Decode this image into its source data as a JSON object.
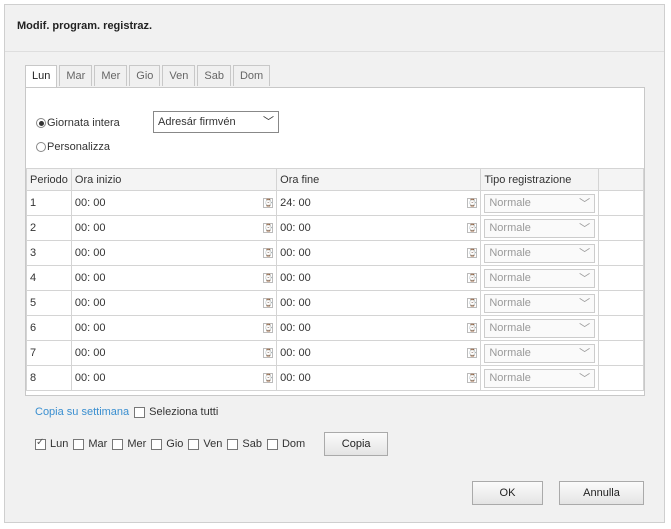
{
  "dialog": {
    "title": "Modif. program. registraz."
  },
  "tabs": [
    {
      "label": "Lun",
      "active": true
    },
    {
      "label": "Mar"
    },
    {
      "label": "Mer"
    },
    {
      "label": "Gio"
    },
    {
      "label": "Ven"
    },
    {
      "label": "Sab"
    },
    {
      "label": "Dom"
    }
  ],
  "mode": {
    "all_day_label": "Giornata intera",
    "all_day_select": "Adresár firmvén",
    "custom_label": "Personalizza"
  },
  "table": {
    "headers": [
      "Periodo",
      "Ora inizio",
      "Ora fine",
      "Tipo registrazione"
    ],
    "rows": [
      {
        "period": "1",
        "start": "00: 00",
        "end": "24: 00",
        "type": "Normale"
      },
      {
        "period": "2",
        "start": "00: 00",
        "end": "00: 00",
        "type": "Normale"
      },
      {
        "period": "3",
        "start": "00: 00",
        "end": "00: 00",
        "type": "Normale"
      },
      {
        "period": "4",
        "start": "00: 00",
        "end": "00: 00",
        "type": "Normale"
      },
      {
        "period": "5",
        "start": "00: 00",
        "end": "00: 00",
        "type": "Normale"
      },
      {
        "period": "6",
        "start": "00: 00",
        "end": "00: 00",
        "type": "Normale"
      },
      {
        "period": "7",
        "start": "00: 00",
        "end": "00: 00",
        "type": "Normale"
      },
      {
        "period": "8",
        "start": "00: 00",
        "end": "00: 00",
        "type": "Normale"
      }
    ]
  },
  "copy": {
    "link_label": "Copia su settimana",
    "select_all_label": "Seleziona tutti",
    "days": [
      {
        "label": "Lun",
        "checked": true
      },
      {
        "label": "Mar",
        "checked": false
      },
      {
        "label": "Mer",
        "checked": false
      },
      {
        "label": "Gio",
        "checked": false
      },
      {
        "label": "Ven",
        "checked": false
      },
      {
        "label": "Sab",
        "checked": false
      },
      {
        "label": "Dom",
        "checked": false
      }
    ],
    "copy_button": "Copia"
  },
  "footer": {
    "ok_label": "OK",
    "cancel_label": "Annulla"
  },
  "colors": {
    "link": "#3a8fd0",
    "background": "#f1f1f1"
  },
  "icons": {
    "time_picker": "clock-icon",
    "dropdown": "chevron-down-icon"
  }
}
